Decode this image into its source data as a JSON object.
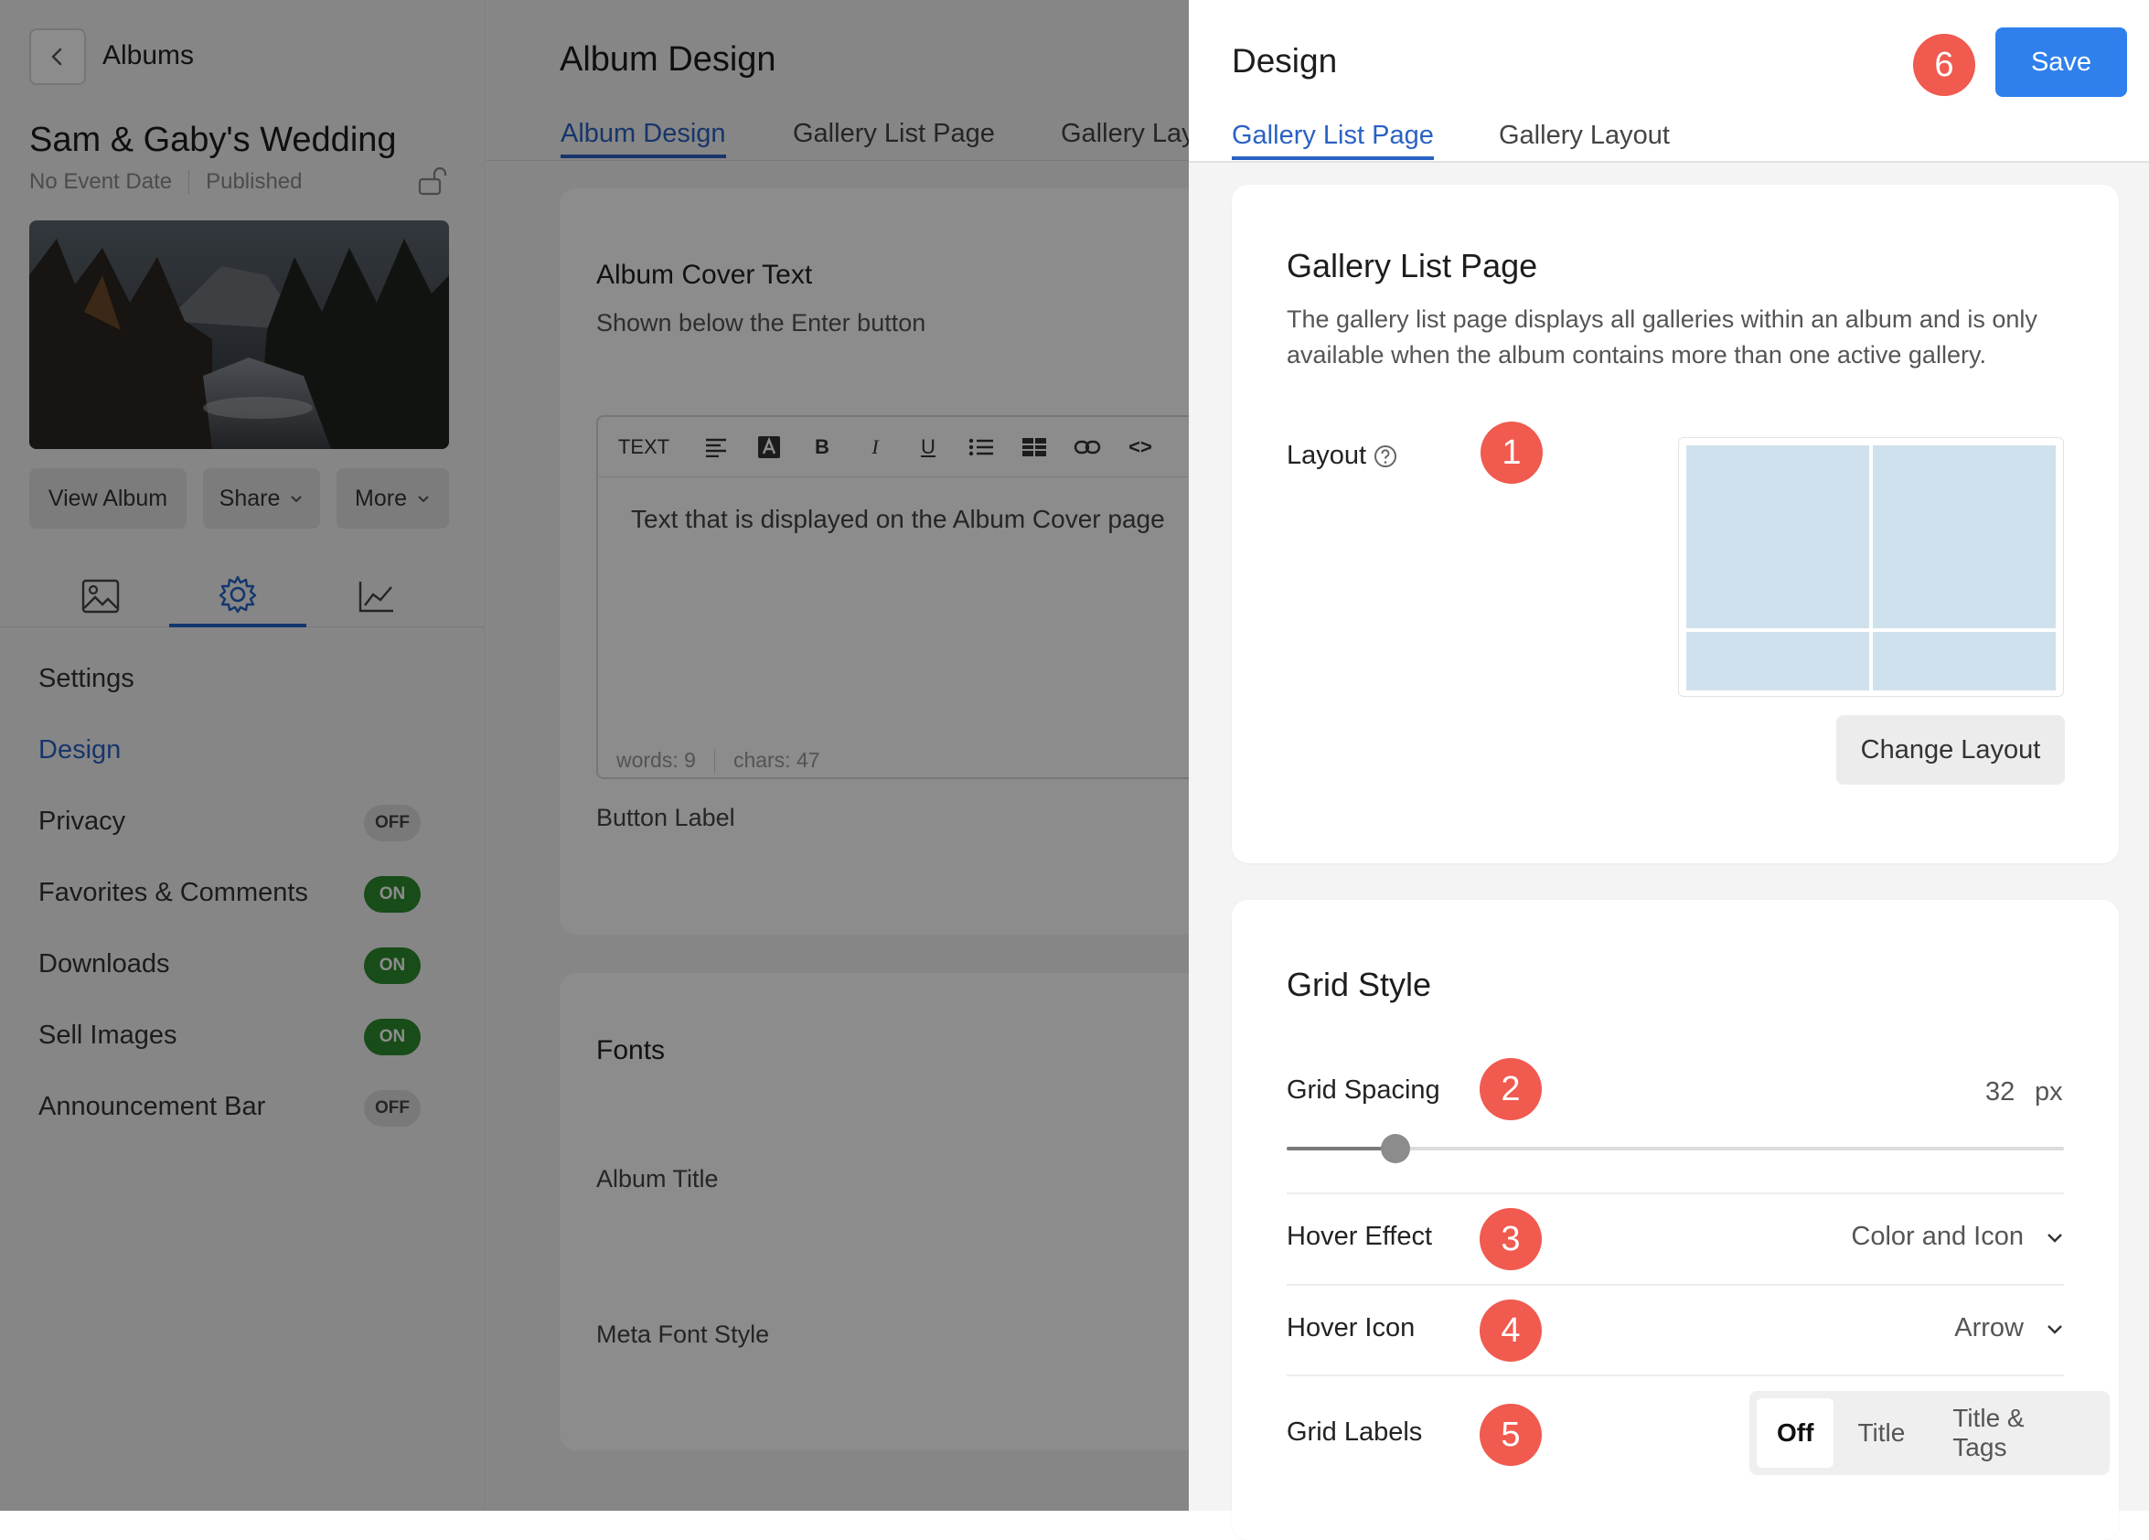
{
  "sidebar": {
    "back_label": "Albums",
    "album_title": "Sam & Gaby's Wedding",
    "event_date": "No Event Date",
    "status": "Published",
    "actions": {
      "view": "View Album",
      "share": "Share",
      "more": "More"
    },
    "menu": [
      {
        "label": "Settings",
        "toggle": ""
      },
      {
        "label": "Design",
        "toggle": ""
      },
      {
        "label": "Privacy",
        "toggle": "OFF"
      },
      {
        "label": "Favorites & Comments",
        "toggle": "ON"
      },
      {
        "label": "Downloads",
        "toggle": "ON"
      },
      {
        "label": "Sell Images",
        "toggle": "ON"
      },
      {
        "label": "Announcement Bar",
        "toggle": "OFF"
      }
    ]
  },
  "middle": {
    "title": "Album Design",
    "tabs": [
      "Album Design",
      "Gallery List Page",
      "Gallery Layout"
    ],
    "cover_card": {
      "heading": "Album Cover Text",
      "subheading": "Shown below the Enter button",
      "toolbar_text": "TEXT",
      "editor_text": "Text that is displayed on the Album Cover page",
      "words": "words: 9",
      "chars": "chars: 47",
      "button_label": "Button Label"
    },
    "fonts_card": {
      "heading": "Fonts",
      "album_title": "Album Title",
      "meta_font": "Meta Font Style"
    }
  },
  "panel": {
    "title": "Design",
    "save_label": "Save",
    "tabs": [
      "Gallery List Page",
      "Gallery Layout"
    ],
    "gallery_list": {
      "heading": "Gallery List Page",
      "description": "The gallery list page displays all galleries within an album and is only available when the album contains more than one active gallery.",
      "layout_label": "Layout",
      "change_layout": "Change Layout"
    },
    "grid_style": {
      "heading": "Grid Style",
      "spacing_label": "Grid Spacing",
      "spacing_value": "32",
      "spacing_unit": "px",
      "spacing_fraction": 0.14,
      "hover_effect_label": "Hover Effect",
      "hover_effect_value": "Color and Icon",
      "hover_icon_label": "Hover Icon",
      "hover_icon_value": "Arrow",
      "grid_labels_label": "Grid Labels",
      "grid_labels_options": [
        "Off",
        "Title",
        "Title & Tags"
      ],
      "grid_labels_selected": "Off"
    },
    "badges": [
      "1",
      "2",
      "3",
      "4",
      "5",
      "6"
    ]
  },
  "colors": {
    "accent": "#2f80ed",
    "badge": "#f05a4f",
    "toggle_on": "#2c8a2c",
    "layout_tile": "#cfe1ec"
  }
}
